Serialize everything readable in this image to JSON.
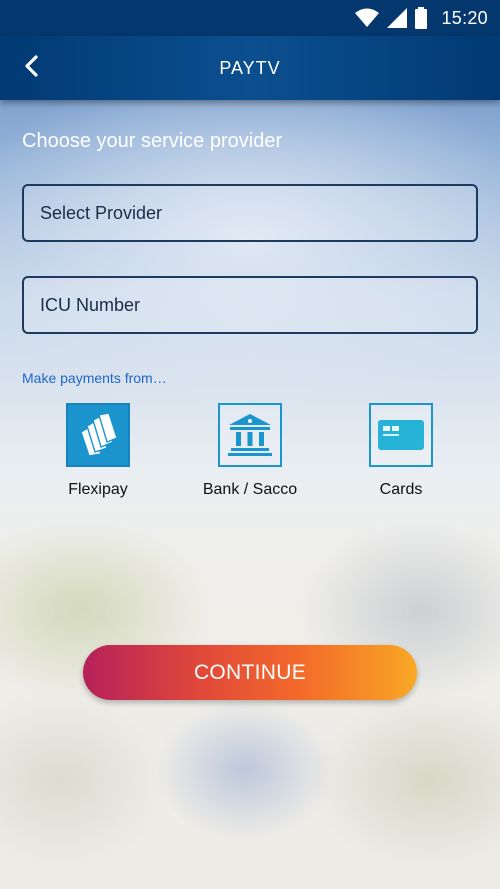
{
  "status_bar": {
    "time": "15:20",
    "icons": [
      "wifi-icon",
      "signal-icon",
      "battery-icon"
    ]
  },
  "app_bar": {
    "title": "PAYTV",
    "back_icon": "chevron-left-icon"
  },
  "form": {
    "heading": "Choose your service provider",
    "provider_placeholder": "Select Provider",
    "icu_placeholder": "ICU Number"
  },
  "payment": {
    "label": "Make payments from…",
    "options": [
      {
        "label": "Flexipay",
        "icon": "flexipay-icon"
      },
      {
        "label": "Bank / Sacco",
        "icon": "bank-icon"
      },
      {
        "label": "Cards",
        "icon": "card-icon"
      }
    ]
  },
  "actions": {
    "continue_label": "CONTINUE"
  },
  "colors": {
    "appbar": "#013a74",
    "accent_blue": "#1c95cf",
    "button_start": "#b5215a",
    "button_end": "#f9a825"
  }
}
